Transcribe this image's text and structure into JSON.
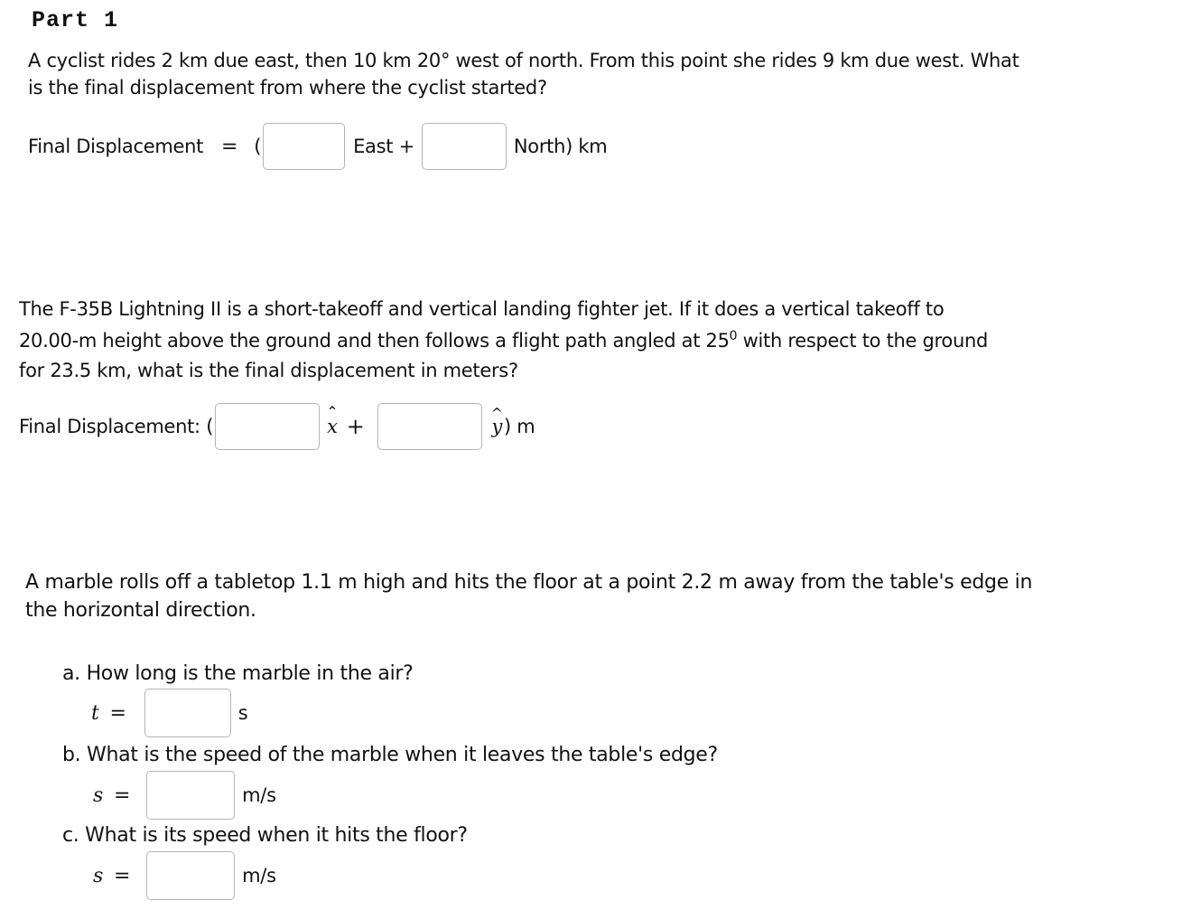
{
  "part_title": "Part 1",
  "q1": {
    "line1": "A cyclist rides 2 km due east, then 10 km 20° west of north. From this point she rides 9 km due west. What",
    "line2": "is the final displacement from where the cyclist started?",
    "label": "Final Displacement",
    "equals": "=",
    "open_paren": "(",
    "east_value": "",
    "east_label": "East +",
    "north_value": "",
    "north_label": "North) km"
  },
  "q2": {
    "line1": "The F-35B Lightning II is a short-takeoff and vertical landing fighter jet. If it does a vertical takeoff to",
    "line2_pre": "20.00-m height above the ground and then follows a flight path angled at 25",
    "line2_sup": "0",
    "line2_post": " with respect to the ground",
    "line3": "for 23.5 km, what is the final displacement in meters?",
    "label": "Final Displacement: (",
    "x_value": "",
    "x_symbol": "x",
    "plus": "+",
    "y_value": "",
    "y_symbol": "y",
    "unit": ") m"
  },
  "q3": {
    "line1": "A marble rolls off a tabletop 1.1 m high and hits the floor at a point 2.2 m away from the table's edge in",
    "line2": "the horizontal direction.",
    "parts": [
      {
        "question": "a. How long is the marble in the air?",
        "var": "t",
        "equals": "=",
        "value": "",
        "unit": "s"
      },
      {
        "question": "b. What is the speed of the marble when it leaves the table's edge?",
        "var": "s",
        "equals": "=",
        "value": "",
        "unit": "m/s"
      },
      {
        "question": "c. What is its speed when it hits the floor?",
        "var": "s",
        "equals": "=",
        "value": "",
        "unit": "m/s"
      }
    ]
  }
}
